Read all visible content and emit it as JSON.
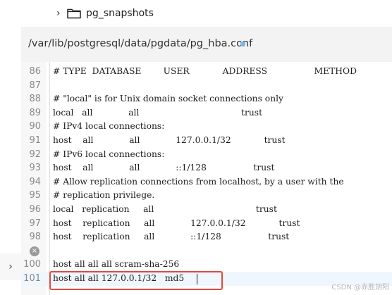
{
  "tree": {
    "chevron": "›",
    "folder_icon": "folder-icon",
    "folder_label": "pg_snapshots"
  },
  "editor": {
    "file_path": "/var/lib/postgresql/data/pgdata/pg_hba.conf",
    "modified_indicator_color": "#7cb4e4",
    "lines": [
      {
        "num": "86",
        "code": "# TYPE  DATABASE        USER            ADDRESS                 METHOD"
      },
      {
        "num": "87",
        "code": ""
      },
      {
        "num": "88",
        "code": "# \"local\" is for Unix domain socket connections only"
      },
      {
        "num": "89",
        "code": "local   all             all                                     trust"
      },
      {
        "num": "90",
        "code": "# IPv4 local connections:"
      },
      {
        "num": "91",
        "code": "host    all             all             127.0.0.1/32            trust"
      },
      {
        "num": "92",
        "code": "# IPv6 local connections:"
      },
      {
        "num": "93",
        "code": "host    all             all             ::1/128                 trust"
      },
      {
        "num": "94",
        "code": "# Allow replication connections from localhost, by a user with the"
      },
      {
        "num": "95",
        "code": "# replication privilege."
      },
      {
        "num": "96",
        "code": "local   replication     all                                     trust"
      },
      {
        "num": "97",
        "code": "host    replication     all             127.0.0.1/32            trust"
      },
      {
        "num": "98",
        "code": "host    replication     all             ::1/128                 trust"
      },
      {
        "num": "99",
        "code": ""
      },
      {
        "num": "100",
        "code": "host all all all scram-sha-256"
      },
      {
        "num": "101",
        "code": "host all all 127.0.0.1/32   md5"
      }
    ]
  },
  "sidebar_toggle": "›",
  "watermark": "CSDN @赤胜胡阳",
  "colors": {
    "highlight_box": "#e5483d",
    "active_line": "#f0f6fd"
  }
}
